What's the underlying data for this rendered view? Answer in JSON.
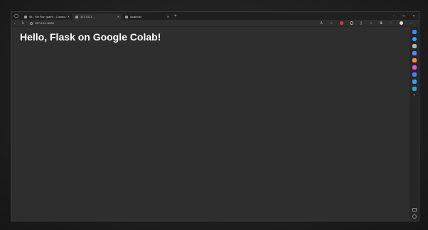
{
  "browser": {
    "tabs": [
      {
        "label": "08 - Set Run (path) - Colaboratory",
        "active": false
      },
      {
        "label": "127.0.0.1",
        "active": true
      },
      {
        "label": "localhost",
        "active": false
      }
    ],
    "new_tab": "+",
    "window_controls": [
      "–",
      "□",
      "×"
    ],
    "address": "127.0.0.1:5000"
  },
  "page": {
    "heading": "Hello, Flask on Google Colab!"
  },
  "sidebar": {
    "icons": [
      {
        "name": "copilot-icon",
        "color": "#2f8cff"
      },
      {
        "name": "search-icon",
        "color": "#3aa0ff"
      },
      {
        "name": "tools-icon",
        "color": "#b3b3b3"
      },
      {
        "name": "shopping-icon",
        "color": "#4e8cff"
      },
      {
        "name": "games-icon",
        "color": "#ff8a3c"
      },
      {
        "name": "office-icon",
        "color": "#d85bd8"
      },
      {
        "name": "outlook-icon",
        "color": "#4f7dff"
      },
      {
        "name": "designer-icon",
        "color": "#3aa0ff"
      },
      {
        "name": "drop-icon",
        "color": "#2fa3d8"
      },
      {
        "name": "add-icon",
        "color": "#9a9a9a"
      }
    ]
  }
}
